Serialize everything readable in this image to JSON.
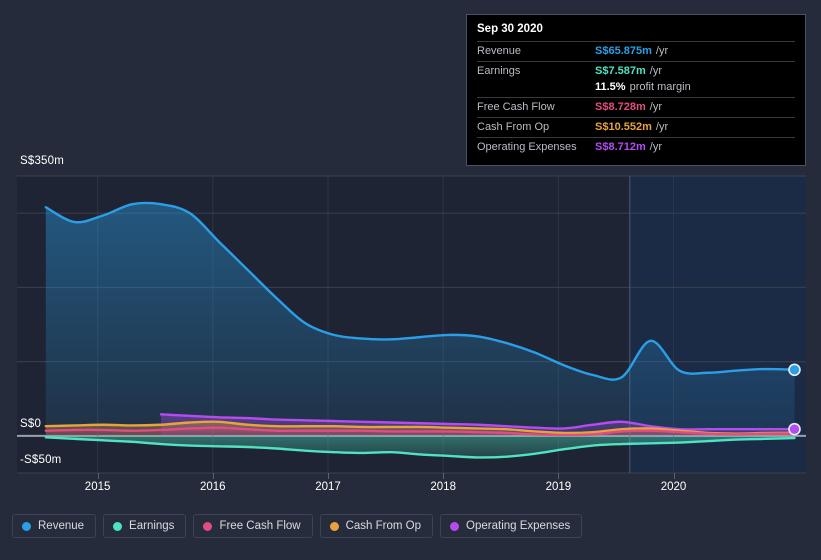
{
  "chart_data": {
    "type": "area",
    "title": "",
    "xlabel": "",
    "ylabel": "",
    "currency": "S$",
    "ylim": [
      -50,
      350
    ],
    "y_ticks": [
      {
        "label": "S$350m",
        "value": 350
      },
      {
        "label": "S$0",
        "value": 0
      },
      {
        "label": "-S$50m",
        "value": -50
      }
    ],
    "gridlines": [
      350,
      300,
      200,
      100,
      0,
      -50
    ],
    "grid": true,
    "legend_position": "bottom",
    "x_ticks": [
      "2015",
      "2016",
      "2017",
      "2018",
      "2019",
      "2020"
    ],
    "x_range": [
      "2014-06",
      "2021-03"
    ],
    "forecast_divider_x": "2019-09",
    "series": [
      {
        "name": "Revenue",
        "color": "#2a9fe8",
        "x": [
          2014.55,
          2014.8,
          2015.05,
          2015.3,
          2015.55,
          2015.8,
          2016.05,
          2016.3,
          2016.55,
          2016.8,
          2017.05,
          2017.3,
          2017.55,
          2017.8,
          2018.05,
          2018.3,
          2018.55,
          2018.8,
          2019.05,
          2019.3,
          2019.55,
          2019.8,
          2020.05,
          2020.3,
          2020.55,
          2020.8,
          2021.05
        ],
        "values": [
          308,
          288,
          297,
          312,
          312,
          300,
          262,
          224,
          186,
          152,
          136,
          131,
          130,
          133,
          136,
          134,
          125,
          112,
          95,
          82,
          79,
          128,
          88,
          85,
          88,
          90,
          89
        ]
      },
      {
        "name": "Earnings",
        "color": "#4fe3c1",
        "x": [
          2014.55,
          2014.8,
          2015.05,
          2015.3,
          2015.55,
          2015.8,
          2016.05,
          2016.3,
          2016.55,
          2016.8,
          2017.05,
          2017.3,
          2017.55,
          2017.8,
          2018.05,
          2018.3,
          2018.55,
          2018.8,
          2019.05,
          2019.3,
          2019.55,
          2019.8,
          2020.05,
          2020.3,
          2020.55,
          2020.8,
          2021.05
        ],
        "values": [
          -2,
          -4,
          -6,
          -8,
          -11,
          -13,
          -14,
          -15,
          -17,
          -20,
          -22,
          -23,
          -22,
          -25,
          -27,
          -29,
          -28,
          -24,
          -18,
          -13,
          -11,
          -10,
          -9,
          -7,
          -5,
          -4,
          -3
        ]
      },
      {
        "name": "Free Cash Flow",
        "color": "#e04e81",
        "x": [
          2014.55,
          2014.8,
          2015.05,
          2015.3,
          2015.55,
          2015.8,
          2016.05,
          2016.3,
          2016.55,
          2016.8,
          2017.05,
          2017.3,
          2017.55,
          2017.8,
          2018.05,
          2018.3,
          2018.55,
          2018.8,
          2019.05,
          2019.3,
          2019.55,
          2019.8,
          2020.05,
          2020.3,
          2020.55,
          2020.8,
          2021.05
        ],
        "values": [
          7,
          8,
          8,
          7,
          8,
          10,
          11,
          9,
          7,
          7,
          7,
          7,
          6,
          6,
          6,
          5,
          4,
          2,
          1,
          2,
          6,
          7,
          5,
          3,
          2,
          3,
          3
        ]
      },
      {
        "name": "Cash From Op",
        "color": "#e8a33d",
        "x": [
          2014.55,
          2014.8,
          2015.05,
          2015.3,
          2015.55,
          2015.8,
          2016.05,
          2016.3,
          2016.55,
          2016.8,
          2017.05,
          2017.3,
          2017.55,
          2017.8,
          2018.05,
          2018.3,
          2018.55,
          2018.8,
          2019.05,
          2019.3,
          2019.55,
          2019.8,
          2020.05,
          2020.3,
          2020.55,
          2020.8,
          2021.05
        ],
        "values": [
          13,
          14,
          15,
          14,
          15,
          18,
          19,
          15,
          13,
          13,
          13,
          12,
          12,
          12,
          11,
          10,
          9,
          6,
          4,
          5,
          9,
          10,
          7,
          4,
          3,
          4,
          4
        ]
      },
      {
        "name": "Operating Expenses",
        "color": "#b44cf0",
        "x": [
          2015.55,
          2015.8,
          2016.05,
          2016.3,
          2016.55,
          2016.8,
          2017.05,
          2017.3,
          2017.55,
          2017.8,
          2018.05,
          2018.3,
          2018.55,
          2018.8,
          2019.05,
          2019.3,
          2019.55,
          2019.8,
          2020.05,
          2020.3,
          2020.55,
          2020.8,
          2021.05
        ],
        "values": [
          29,
          27,
          25,
          24,
          22,
          21,
          20,
          19,
          18,
          17,
          16,
          15,
          13,
          11,
          10,
          15,
          19,
          13,
          9,
          9,
          9,
          9,
          9
        ]
      }
    ],
    "endpoints": [
      {
        "series": "Revenue",
        "color": "#2a9fe8",
        "x": 2021.05,
        "value": 89
      },
      {
        "series": "Operating Expenses",
        "color": "#b44cf0",
        "x": 2021.05,
        "value": 9
      }
    ]
  },
  "tooltip": {
    "date": "Sep 30 2020",
    "rows": [
      {
        "label": "Revenue",
        "value": "S$65.875m",
        "unit": "/yr",
        "color": "#2a9fe8"
      },
      {
        "label": "Earnings",
        "value": "S$7.587m",
        "unit": "/yr",
        "color": "#4fe3c1"
      },
      {
        "label": "",
        "value": "11.5%",
        "unit": "profit margin",
        "color": "#ffffff"
      },
      {
        "label": "Free Cash Flow",
        "value": "S$8.728m",
        "unit": "/yr",
        "color": "#e04e81"
      },
      {
        "label": "Cash From Op",
        "value": "S$10.552m",
        "unit": "/yr",
        "color": "#e8a33d"
      },
      {
        "label": "Operating Expenses",
        "value": "S$8.712m",
        "unit": "/yr",
        "color": "#b44cf0"
      }
    ]
  },
  "legend": {
    "items": [
      {
        "label": "Revenue",
        "color": "#2a9fe8"
      },
      {
        "label": "Earnings",
        "color": "#4fe3c1"
      },
      {
        "label": "Free Cash Flow",
        "color": "#e04e81"
      },
      {
        "label": "Cash From Op",
        "color": "#e8a33d"
      },
      {
        "label": "Operating Expenses",
        "color": "#b44cf0"
      }
    ]
  },
  "colors": {
    "background": "#252b3a",
    "plot_background": "#1e2433",
    "grid": "#39404f",
    "baseline": "#9aa0ad",
    "forecast_band": "#1b3254"
  }
}
